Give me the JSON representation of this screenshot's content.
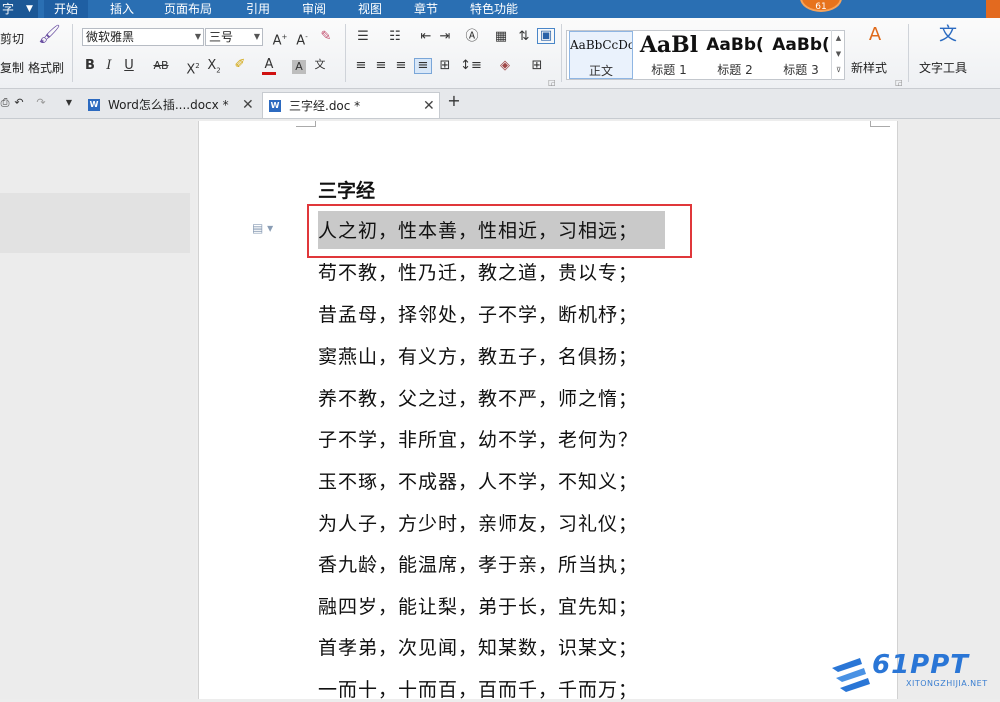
{
  "menubar": {
    "app_label": "字",
    "tabs": [
      "开始",
      "插入",
      "页面布局",
      "引用",
      "审阅",
      "视图",
      "章节",
      "特色功能"
    ],
    "active_tab": "开始",
    "badge": "61"
  },
  "ribbon": {
    "cut_label": "剪切",
    "copy_label": "复制",
    "format_painter_label": "格式刷",
    "font_name": "微软雅黑",
    "font_size": "三号",
    "styles": [
      {
        "sample": "AaBbCcDc",
        "label": "正文"
      },
      {
        "sample": "AaBl",
        "label": "标题 1"
      },
      {
        "sample": "AaBb(",
        "label": "标题 2"
      },
      {
        "sample": "AaBb(",
        "label": "标题 3"
      }
    ],
    "new_style_label": "新样式",
    "text_tools_label": "文字工具"
  },
  "tabs": [
    {
      "title": "Word怎么插....docx *",
      "active": false
    },
    {
      "title": "三字经.doc *",
      "active": true
    }
  ],
  "document": {
    "title": "三字经",
    "lines": [
      "人之初，性本善，性相近，习相远；",
      "苟不教，性乃迁，教之道，贵以专；",
      "昔孟母，择邻处，子不学，断机杼；",
      "窦燕山，有义方，教五子，名俱扬；",
      "养不教，父之过，教不严，师之惰；",
      "子不学，非所宜，幼不学，老何为？",
      "玉不琢，不成器，人不学，不知义；",
      "为人子，方少时，亲师友，习礼仪；",
      "香九龄，能温席，孝于亲，所当执；",
      "融四岁，能让梨，弟于长，宜先知；",
      "首孝弟，次见闻，知某数，识某文；",
      "一而十，十而百，百而千，千而万；"
    ]
  },
  "watermark": {
    "logo_text": "61PPT",
    "sub_text": "XITONGZHIJIA.NET"
  }
}
